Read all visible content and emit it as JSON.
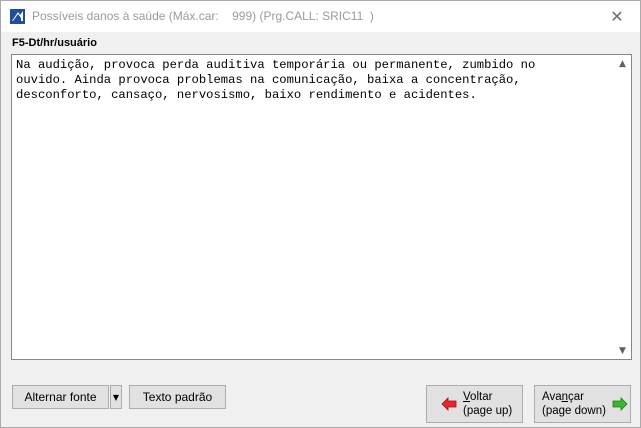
{
  "window": {
    "title": "Possíveis danos à saúde (Máx.car:    999) (Prg.CALL: SRIC11  )",
    "close_glyph": "✕",
    "app_icon": "app-logo-icon"
  },
  "field": {
    "label": "F5-Dt/hr/usuário",
    "text": "Na audição, provoca perda auditiva temporária ou permanente, zumbido no\nouvido. Ainda provoca problemas na comunicação, baixa a concentração,\ndesconforto, cansaço, nervosismo, baixo rendimento e acidentes."
  },
  "scrollbar": {
    "up_glyph": "▲",
    "down_glyph": "▼"
  },
  "buttons": {
    "alternate_font": "Alternar fonte",
    "dropdown_glyph": "▼",
    "default_text": "Texto padrão",
    "back": {
      "line1_mnemonic": "V",
      "line1_rest": "oltar",
      "line2": "(page up)",
      "icon": "arrow-left-icon"
    },
    "next": {
      "line1_pre": "Ava",
      "line1_mnemonic": "n",
      "line1_rest": "çar",
      "line2": "(page down)",
      "icon": "arrow-right-icon"
    }
  },
  "colors": {
    "back_arrow": "#e8262a",
    "next_arrow": "#3cb830"
  }
}
